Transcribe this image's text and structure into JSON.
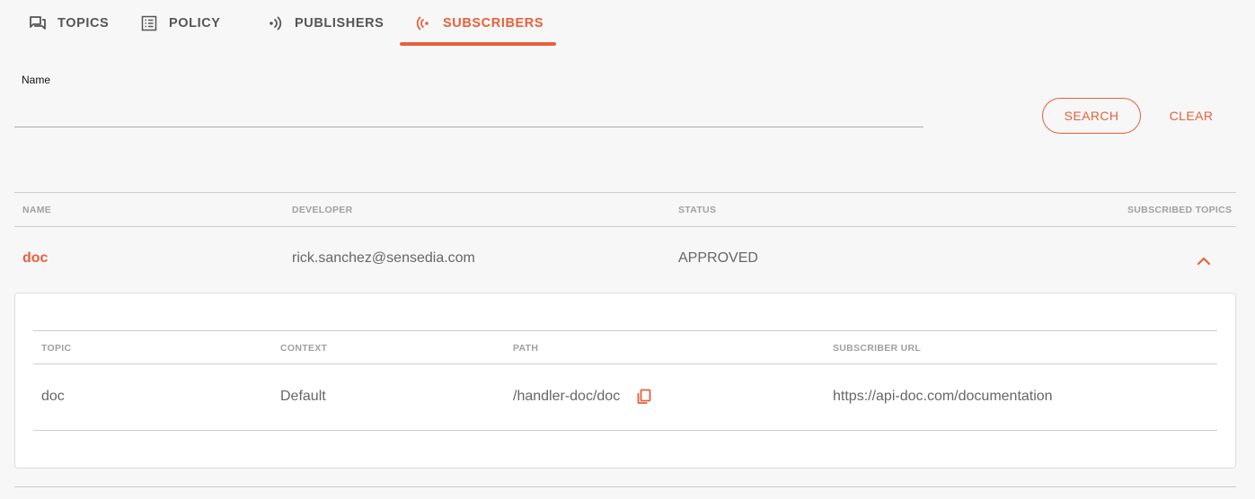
{
  "tabs": [
    {
      "label": "TOPICS",
      "icon": "forum-icon",
      "active": false
    },
    {
      "label": "POLICY",
      "icon": "list-icon",
      "active": false
    },
    {
      "label": "PUBLISHERS",
      "icon": "broadcast-icon",
      "active": false
    },
    {
      "label": "SUBSCRIBERS",
      "icon": "antenna-icon",
      "active": true
    }
  ],
  "filter": {
    "name_label": "Name",
    "name_value": "",
    "search_label": "SEARCH",
    "clear_label": "CLEAR"
  },
  "table": {
    "headers": [
      "NAME",
      "DEVELOPER",
      "STATUS",
      "SUBSCRIBED TOPICS"
    ],
    "rows": [
      {
        "name": "doc",
        "developer": "rick.sanchez@sensedia.com",
        "status": "APPROVED",
        "expanded": true
      }
    ]
  },
  "subtable": {
    "headers": [
      "TOPIC",
      "CONTEXT",
      "PATH",
      "SUBSCRIBER URL"
    ],
    "rows": [
      {
        "topic": "doc",
        "context": "Default",
        "path": "/handler-doc/doc",
        "subscriber_url": "https://api-doc.com/documentation"
      }
    ]
  },
  "colors": {
    "accent": "#e8603c",
    "background": "#f7f7f7"
  }
}
